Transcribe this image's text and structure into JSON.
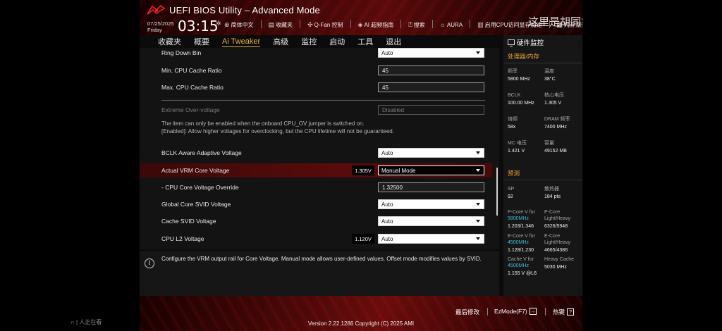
{
  "header": {
    "title": "UEFI BIOS Utility – Advanced Mode",
    "date": "07/25/2025",
    "day": "Friday",
    "time": "03:15",
    "toolbar": [
      {
        "icon": "globe-icon",
        "glyph": "⊕",
        "label": "简体中文"
      },
      {
        "icon": "bookmark-icon",
        "glyph": "▤",
        "label": "收藏夹"
      },
      {
        "icon": "fan-icon",
        "glyph": "✣",
        "label": "Q-Fan 控制"
      },
      {
        "icon": "ai-icon",
        "glyph": "◈",
        "label": "AI 超频指南"
      },
      {
        "icon": "search-icon",
        "glyph": "⍰",
        "label": "搜索"
      },
      {
        "icon": "aura-icon",
        "glyph": "☼",
        "label": "AURA"
      },
      {
        "icon": "memory-icon",
        "glyph": "▥",
        "label": "启用CPU访问显存加速"
      },
      {
        "icon": "memory-test-icon",
        "glyph": "▦",
        "label": "内存测试"
      }
    ]
  },
  "watermark": {
    "text": "这里是胡同学",
    "brand": "bilibili"
  },
  "tabs": [
    {
      "label": "收藏夹",
      "active": false
    },
    {
      "label": "概要",
      "active": false
    },
    {
      "label": "Ai Tweaker",
      "active": true
    },
    {
      "label": "高级",
      "active": false
    },
    {
      "label": "监控",
      "active": false
    },
    {
      "label": "启动",
      "active": false
    },
    {
      "label": "工具",
      "active": false
    },
    {
      "label": "退出",
      "active": false
    }
  ],
  "settings": {
    "ring_down_bin": {
      "label": "Ring Down Bin",
      "value": "Auto"
    },
    "min_cache_ratio": {
      "label": "Min. CPU Cache Ratio",
      "value": "45"
    },
    "max_cache_ratio": {
      "label": "Max. CPU Cache Ratio",
      "value": "45"
    },
    "extreme_ov": {
      "label": "Extreme Over-voltage",
      "value": "Disabled"
    },
    "note": "The item can only be enabled when the onboard CPU_OV jumper is switched on.\n[Enabled]: Allow higher voltages for overclocking, but the CPU lifetime will not be guaranteed.",
    "bclk_aware": {
      "label": "BCLK Aware Adaptive Voltage",
      "value": "Auto"
    },
    "vrm_core": {
      "label": "Actual VRM Core Voltage",
      "reading": "1.305V",
      "value": "Manual Mode"
    },
    "core_override": {
      "label": "- CPU Core Voltage Override",
      "value": "1.32500"
    },
    "global_svid": {
      "label": "Global Core SVID Voltage",
      "value": "Auto"
    },
    "cache_svid": {
      "label": "Cache SVID Voltage",
      "value": "Auto"
    },
    "l2_voltage": {
      "label": "CPU L2 Voltage",
      "reading": "1.120V",
      "value": "Auto"
    }
  },
  "help": "Configure the VRM output rail for Core Voltage. Manual mode allows user-defined values. Offset mode modifies values by SVID.",
  "hw_monitor": {
    "title": "硬件监控",
    "section_cpu": "处理器/内存",
    "freq_k": "频率",
    "freq_v": "5800 MHz",
    "temp_k": "温度",
    "temp_v": "38°C",
    "bclk_k": "BCLK",
    "bclk_v": "100.00 MHz",
    "vcore_k": "核心电压",
    "vcore_v": "1.305 V",
    "ratio_k": "倍频",
    "ratio_v": "58x",
    "dram_k": "DRAM 频率",
    "dram_v": "7400 MHz",
    "mc_k": "MC 电压",
    "mc_v": "1.421 V",
    "cap_k": "容量",
    "cap_v": "49152 MB",
    "section_pred": "预测",
    "sp_k": "SP",
    "sp_v": "92",
    "cool_k": "散热器",
    "cool_v": "184 pts",
    "pcore_k": "P-Core V for",
    "pcore_freq": "5800MHz",
    "pcore_v": "1.203/1.346",
    "pcore_lh_k": "P-Core Light/Heavy",
    "pcore_lh_v": "6326/5948",
    "ecore_k": "E-Core V for",
    "ecore_freq": "4500MHz",
    "ecore_v": "1.128/1.230",
    "ecore_lh_k": "E-Core Light/Heavy",
    "ecore_lh_v": "4665/4386",
    "cache_k": "Cache V for",
    "cache_freq": "4500MHz",
    "cache_v": "1.155 V @L6",
    "hcache_k": "Heavy Cache",
    "hcache_v": "5030 MHz"
  },
  "footer": {
    "last_modified": "最后修改",
    "ezmode": "EzMode(F7)",
    "hotkeys": "热键",
    "hotkeys_glyph": "?",
    "version": "Version 2.22.1286 Copyright (C) 2025 AMI"
  },
  "stream_status": "∩ | 人正在看"
}
